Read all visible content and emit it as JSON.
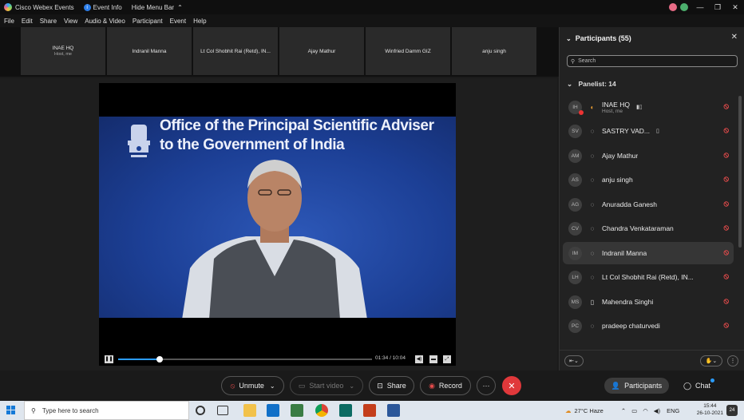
{
  "titlebar": {
    "app_name": "Cisco Webex Events",
    "event_info": "Event Info",
    "hide_menu": "Hide Menu Bar",
    "min": "—",
    "max": "❐",
    "close": "✕"
  },
  "menu": [
    "File",
    "Edit",
    "Share",
    "View",
    "Audio & Video",
    "Participant",
    "Event",
    "Help"
  ],
  "thumbnails": [
    {
      "name": "INAE HQ",
      "sub": "Host, me"
    },
    {
      "name": "Indranil Manna",
      "sub": ""
    },
    {
      "name": "Lt Col Shobhit Rai (Retd), IN...",
      "sub": ""
    },
    {
      "name": "Ajay Mathur",
      "sub": ""
    },
    {
      "name": "Winfried Damm GIZ",
      "sub": ""
    },
    {
      "name": "anju singh",
      "sub": ""
    }
  ],
  "video": {
    "headline_1": "Office of the Principal Scientific Adviser",
    "headline_2": "to the Government of India",
    "time": "01:34 / 10:04",
    "progress": 0.165
  },
  "panel": {
    "title": "Participants (55)",
    "search_placeholder": "Search",
    "panelist_header": "Panelist: 14",
    "participants": [
      {
        "initials": "IH",
        "name": "INAE HQ",
        "role": "Host, me",
        "extra": "▮▯"
      },
      {
        "initials": "SV",
        "name": "SASTRY VAD...",
        "role": "",
        "extra": "▯"
      },
      {
        "initials": "AM",
        "name": "Ajay Mathur",
        "role": "",
        "extra": ""
      },
      {
        "initials": "AS",
        "name": "anju singh",
        "role": "",
        "extra": ""
      },
      {
        "initials": "AG",
        "name": "Anuradda Ganesh",
        "role": "",
        "extra": ""
      },
      {
        "initials": "CV",
        "name": "Chandra Venkataraman",
        "role": "",
        "extra": ""
      },
      {
        "initials": "IM",
        "name": "Indranil Manna",
        "role": "",
        "extra": ""
      },
      {
        "initials": "LH",
        "name": "Lt Col Shobhit Rai (Retd), IN...",
        "role": "",
        "extra": ""
      },
      {
        "initials": "MS",
        "name": "Mahendra Singhi",
        "role": "",
        "extra": ""
      },
      {
        "initials": "PC",
        "name": "pradeep chaturvedi",
        "role": "",
        "extra": ""
      }
    ]
  },
  "toolbar": {
    "unmute": "Unmute",
    "start_video": "Start video",
    "share": "Share",
    "record": "Record",
    "more": "···",
    "leave": "✕",
    "participants": "Participants",
    "chat": "Chat"
  },
  "taskbar": {
    "search_placeholder": "Type here to search",
    "weather": "27°C Haze",
    "lang": "ENG",
    "time": "15:44",
    "date": "26-10-2021",
    "notifications": "24"
  },
  "colors": {
    "accent": "#2b9cff",
    "leave": "#e0383b",
    "mute": "#e24b4b",
    "slide_blue": "#1c3f95"
  }
}
